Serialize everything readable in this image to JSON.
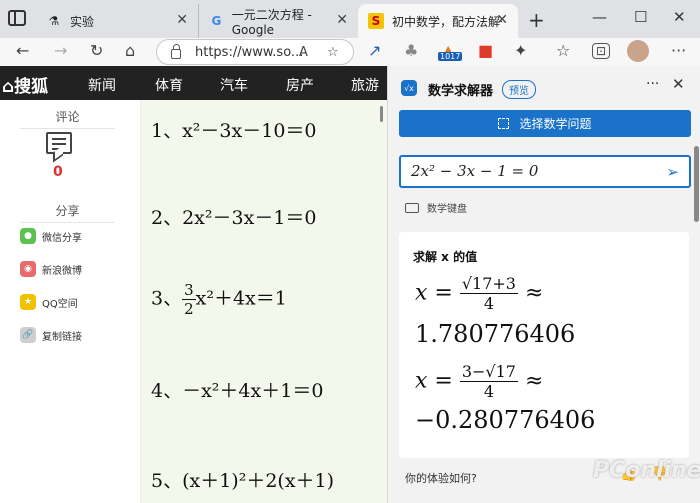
{
  "tabs": [
    {
      "title": "实验",
      "icon": "flask-icon"
    },
    {
      "title": "一元二次方程 - Google",
      "icon": "google-icon"
    },
    {
      "title": "初中数学，配方法解一元",
      "icon": "sohu-icon"
    }
  ],
  "toolbar": {
    "url": "https://www.so...",
    "extension_badge": "1017"
  },
  "site": {
    "logo": "搜狐",
    "nav": [
      "新闻",
      "体育",
      "汽车",
      "房产",
      "旅游"
    ],
    "sidebar": {
      "comment_label": "评论",
      "comment_count": "0",
      "share_label": "分享",
      "share_items": [
        "微信分享",
        "新浪微博",
        "QQ空间",
        "复制链接"
      ]
    },
    "equations": [
      "1、x²－3x－10＝0",
      "2、2x²－3x－1＝0",
      "3、",
      "4、－x²＋4x＋1＝0",
      "5、(x＋1)²＋2(x＋1)"
    ],
    "eq3_num": "3",
    "eq3_den": "2",
    "eq3_rest": "x²＋4x＝1"
  },
  "panel": {
    "title": "数学求解器",
    "badge": "预览",
    "select_button": "选择数学问题",
    "input_value": "2x² − 3x − 1 = 0",
    "keyboard_label": "数学键盘",
    "result_title": "求解 x 的值",
    "sol1_lhs": "x =",
    "sol1_num": "√17+3",
    "sol1_den": "4",
    "sol1_approx": "≈",
    "sol1_value": "1.780776406",
    "sol2_lhs": "x =",
    "sol2_num": "3−√17",
    "sol2_den": "4",
    "sol2_approx": "≈",
    "sol2_value": "−0.280776406",
    "feedback": "你的体验如何?"
  },
  "watermark": "PConline"
}
